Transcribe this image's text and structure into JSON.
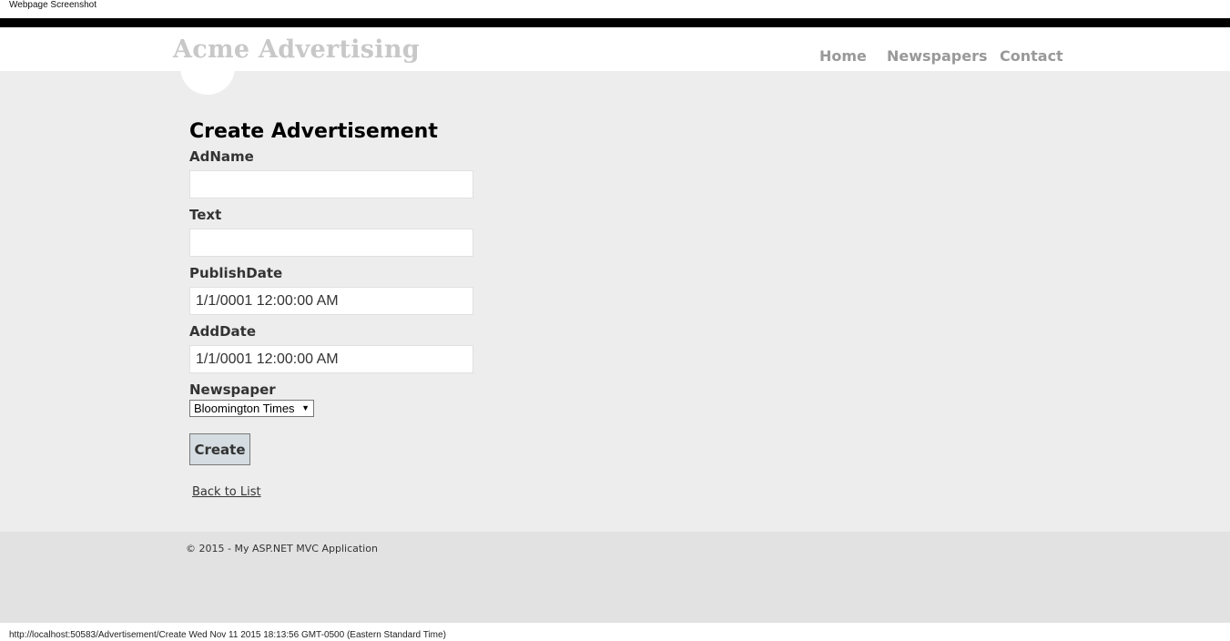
{
  "screenshot": {
    "title": "Webpage Screenshot",
    "status_url": "http://localhost:50583/Advertisement/Create Wed Nov 11 2015 18:13:56 GMT-0500 (Eastern Standard Time)"
  },
  "header": {
    "site_title": "Acme Advertising",
    "nav": [
      {
        "label": "Home"
      },
      {
        "label": "Newspapers"
      },
      {
        "label": "Contact"
      }
    ]
  },
  "form": {
    "title": "Create Advertisement",
    "fields": [
      {
        "label": "AdName",
        "value": ""
      },
      {
        "label": "Text",
        "value": ""
      },
      {
        "label": "PublishDate",
        "value": "1/1/0001 12:00:00 AM"
      },
      {
        "label": "AddDate",
        "value": "1/1/0001 12:00:00 AM"
      }
    ],
    "newspaper": {
      "label": "Newspaper",
      "selected": "Bloomington Times"
    },
    "submit_label": "Create",
    "back_link": "Back to List"
  },
  "footer": {
    "copyright": "© 2015 - My ASP.NET MVC Application"
  },
  "colors": {
    "topbar": "#000000",
    "content_bg": "#ededed",
    "footer_bg": "#e2e2e2",
    "title_gray": "#c8c8c8",
    "nav_gray": "#999999",
    "button_bg": "#d5dde2"
  }
}
